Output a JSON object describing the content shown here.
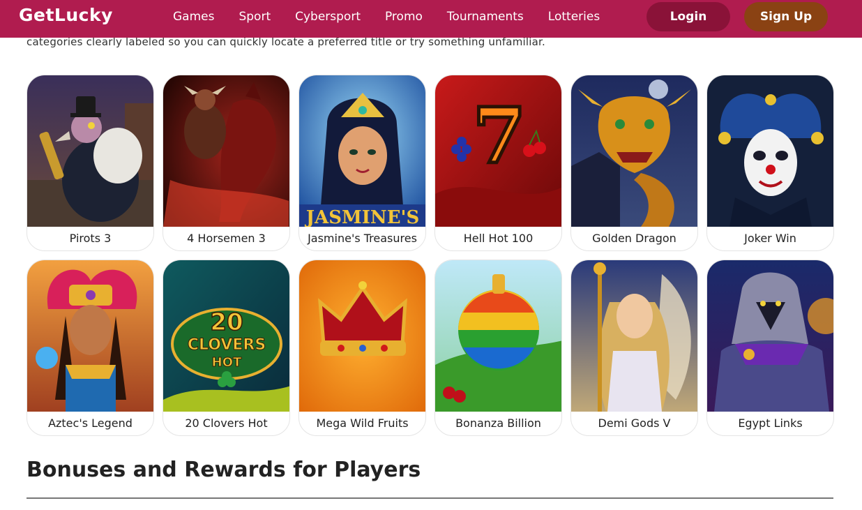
{
  "header": {
    "logo": "GetLucky",
    "nav": [
      "Games",
      "Sport",
      "Cybersport",
      "Promo",
      "Tournaments",
      "Lotteries"
    ],
    "login_label": "Login",
    "signup_label": "Sign Up",
    "colors": {
      "bar": "#b01c4f",
      "login": "#8a1238",
      "signup": "#8a4213"
    }
  },
  "intro_text": "categories clearly labeled so you can quickly locate a preferred title or try something unfamiliar.",
  "games": [
    {
      "title": "Pirots 3",
      "art": "vulture-pirate-art"
    },
    {
      "title": "4 Horsemen 3",
      "art": "horseman-art"
    },
    {
      "title": "Jasmine's Treasures",
      "art": "jasmine-art"
    },
    {
      "title": "Hell Hot 100",
      "art": "lucky-seven-art"
    },
    {
      "title": "Golden Dragon",
      "art": "dragon-art"
    },
    {
      "title": "Joker Win",
      "art": "joker-art"
    },
    {
      "title": "Aztec's Legend",
      "art": "aztec-warrior-art"
    },
    {
      "title": "20 Clovers Hot",
      "art": "clovers-art"
    },
    {
      "title": "Mega Wild Fruits",
      "art": "crown-art"
    },
    {
      "title": "Bonanza Billion",
      "art": "fruit-bomb-art"
    },
    {
      "title": "Demi Gods V",
      "art": "goddess-art"
    },
    {
      "title": "Egypt Links",
      "art": "anubis-art"
    }
  ],
  "art_text": {
    "jasmine_logo": "JASMINE'S",
    "seven": "7",
    "clovers_num": "20",
    "clovers_word": "CLOVERS",
    "clovers_hot": "HOT"
  },
  "section_title": "Bonuses and Rewards for Players"
}
